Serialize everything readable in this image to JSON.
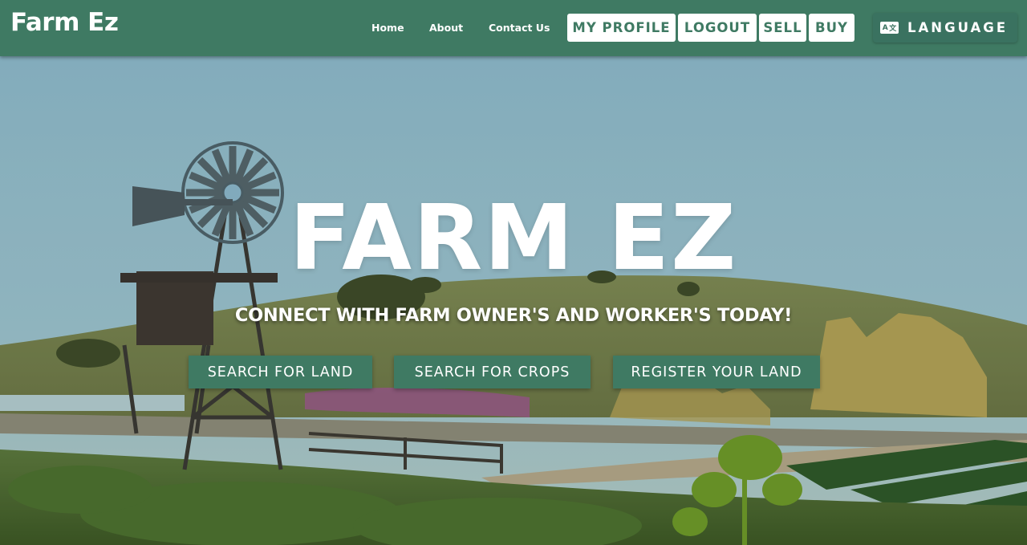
{
  "header": {
    "brand": "Farm Ez",
    "nav": {
      "home": "Home",
      "about": "About",
      "contact": "Contact Us"
    },
    "actions": {
      "my_profile": "MY PROFILE",
      "logout": "LOGOUT",
      "sell": "SELL",
      "buy": "BUY"
    },
    "language": {
      "label": "LANGUAGE",
      "icon": "translate-icon",
      "icon_glyph_a": "A",
      "icon_glyph_b": "文"
    }
  },
  "hero": {
    "title": "FARM EZ",
    "subtitle": "CONNECT WITH FARM OWNER'S AND WORKER'S TODAY!",
    "buttons": {
      "search_land": "SEARCH FOR LAND",
      "search_crops": "SEARCH FOR CROPS",
      "register_land": "REGISTER YOUR LAND"
    }
  },
  "colors": {
    "brand_green": "#3f7a63",
    "white": "#ffffff"
  }
}
